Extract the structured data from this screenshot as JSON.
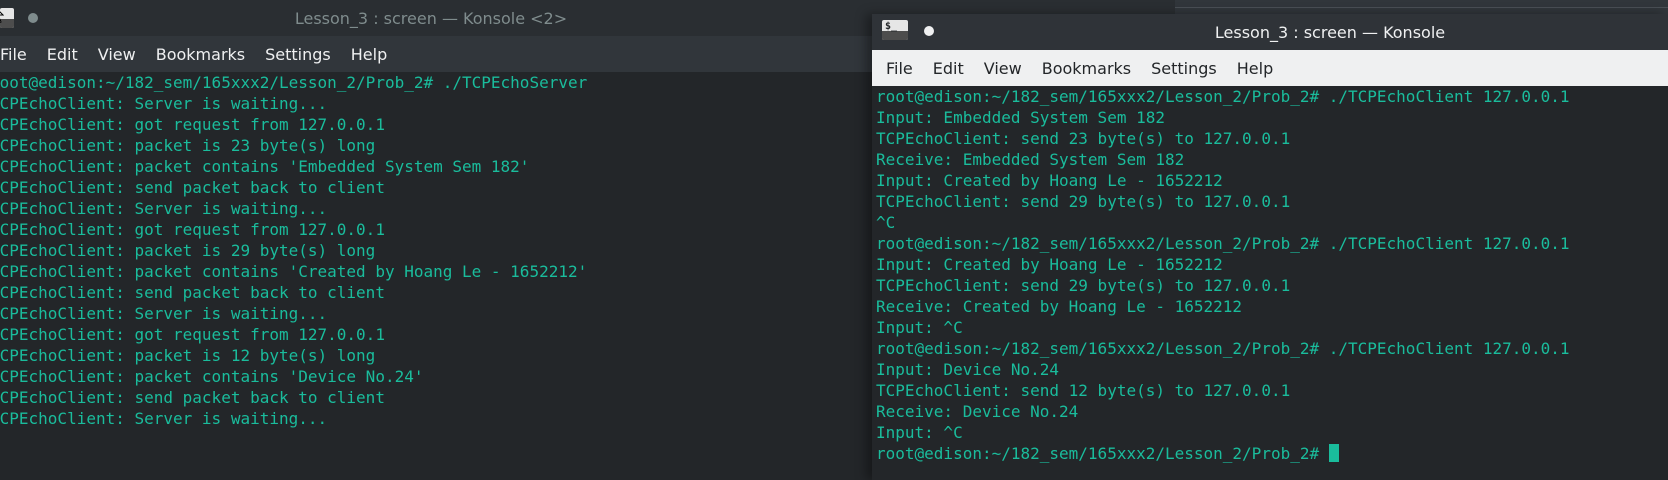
{
  "left_window": {
    "title": "Lesson_3 : screen — Konsole <2>",
    "menu": [
      "File",
      "Edit",
      "View",
      "Bookmarks",
      "Settings",
      "Help"
    ],
    "lines": [
      "root@edison:~/182_sem/165xxx2/Lesson_2/Prob_2# ./TCPEchoServer",
      "TCPEchoClient: Server is waiting...",
      "TCPEchoClient: got request from 127.0.0.1",
      "TCPEchoClient: packet is 23 byte(s) long",
      "TCPEchoClient: packet contains 'Embedded System Sem 182'",
      "TCPEchoClient: send packet back to client",
      "TCPEchoClient: Server is waiting...",
      "TCPEchoClient: got request from 127.0.0.1",
      "TCPEchoClient: packet is 29 byte(s) long",
      "TCPEchoClient: packet contains 'Created by Hoang Le - 1652212'",
      "TCPEchoClient: send packet back to client",
      "TCPEchoClient: Server is waiting...",
      "TCPEchoClient: got request from 127.0.0.1",
      "TCPEchoClient: packet is 12 byte(s) long",
      "TCPEchoClient: packet contains 'Device No.24'",
      "TCPEchoClient: send packet back to client",
      "TCPEchoClient: Server is waiting..."
    ]
  },
  "right_window": {
    "title": "Lesson_3 : screen — Konsole",
    "menu": [
      "File",
      "Edit",
      "View",
      "Bookmarks",
      "Settings",
      "Help"
    ],
    "lines": [
      "root@edison:~/182_sem/165xxx2/Lesson_2/Prob_2# ./TCPEchoClient 127.0.0.1",
      "Input: Embedded System Sem 182",
      "TCPEchoClient: send 23 byte(s) to 127.0.0.1",
      "Receive: Embedded System Sem 182",
      "Input: Created by Hoang Le - 1652212",
      "TCPEchoClient: send 29 byte(s) to 127.0.0.1",
      "^C",
      "root@edison:~/182_sem/165xxx2/Lesson_2/Prob_2# ./TCPEchoClient 127.0.0.1",
      "Input: Created by Hoang Le - 1652212",
      "TCPEchoClient: send 29 byte(s) to 127.0.0.1",
      "Receive: Created by Hoang Le - 1652212",
      "Input: ^C",
      "root@edison:~/182_sem/165xxx2/Lesson_2/Prob_2# ./TCPEchoClient 127.0.0.1",
      "Input: Device No.24",
      "TCPEchoClient: send 12 byte(s) to 127.0.0.1",
      "Receive: Device No.24",
      "Input: ^C",
      "root@edison:~/182_sem/165xxx2/Lesson_2/Prob_2# "
    ],
    "app_icon_text": "$_"
  },
  "colors": {
    "terminal_text": "#1abc9c",
    "terminal_bg": "#232629",
    "inactive_title": "#7f8c8d",
    "active_title": "#eff0f1"
  },
  "icons": {
    "mouse": "mouse-pointer-icon",
    "app": "konsole-app-icon",
    "keep_above": "keep-above-dot-icon"
  }
}
